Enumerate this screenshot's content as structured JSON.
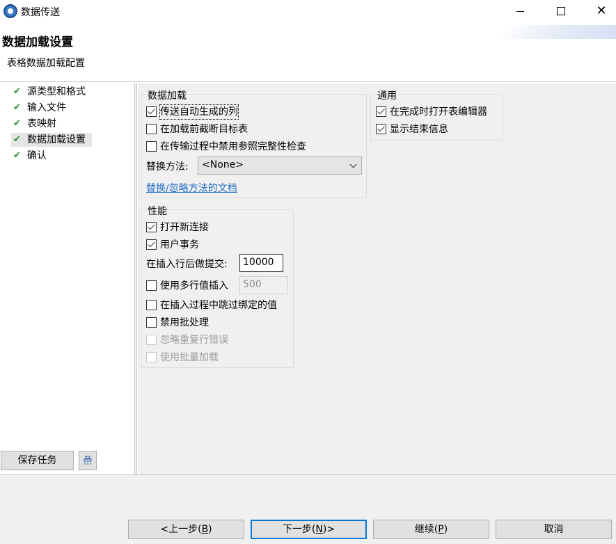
{
  "window": {
    "title": "数据传送",
    "icon": "app-icon",
    "controls": [
      "minimize-icon",
      "maximize-icon",
      "close-icon"
    ],
    "close_glyph": "✕"
  },
  "header": {
    "title": "数据加载设置",
    "subtitle": "表格数据加载配置"
  },
  "sidebar": {
    "steps": [
      {
        "label": "源类型和格式",
        "done": true
      },
      {
        "label": "输入文件",
        "done": true
      },
      {
        "label": "表映射",
        "done": true
      },
      {
        "label": "数据加载设置",
        "done": true,
        "active": true
      },
      {
        "label": "确认",
        "done": true
      }
    ],
    "check_glyph": "✔",
    "save_task": "保存任务",
    "tool_icon": "stamp-icon"
  },
  "data_load": {
    "legend": "数据加载",
    "options": [
      {
        "label": "传送自动生成的列",
        "checked": true
      },
      {
        "label": "在加载前截断目标表",
        "checked": false
      },
      {
        "label": "在传输过程中禁用参照完整性检查",
        "checked": false
      }
    ],
    "replace_method_label": "替换方法:",
    "replace_method_value": "<None>",
    "doc_link": "替换/忽略方法的文档"
  },
  "general": {
    "legend": "通用",
    "options": [
      {
        "label": "在完成时打开表编辑器",
        "checked": true
      },
      {
        "label": "显示结束信息",
        "checked": true
      }
    ]
  },
  "performance": {
    "legend": "性能",
    "open_new_connection": {
      "label": "打开新连接",
      "checked": true
    },
    "user_transaction": {
      "label": "用户事务",
      "checked": true
    },
    "commit_after_label": "在插入行后做提交:",
    "commit_after_value": "10000",
    "multi_row_insert": {
      "label": "使用多行值插入",
      "checked": false
    },
    "multi_row_value": "500",
    "skip_bound_values": {
      "label": "在插入过程中跳过绑定的值",
      "checked": false
    },
    "disable_batch": {
      "label": "禁用批处理",
      "checked": false
    },
    "ignore_duplicate": {
      "label": "忽略重复行错误",
      "checked": false,
      "disabled": true
    },
    "use_bulk_load": {
      "label": "使用批量加载",
      "checked": false,
      "disabled": true
    }
  },
  "footer": {
    "back": {
      "prefix": "<上一步(",
      "key": "B",
      "suffix": ")"
    },
    "next": {
      "prefix": "下一步(",
      "key": "N",
      "suffix": ")>"
    },
    "continue": {
      "prefix": "继续(",
      "key": "P",
      "suffix": ")"
    },
    "cancel": "取消"
  },
  "colors": {
    "accent": "#0078d7",
    "check_green": "#2f8a3a",
    "link": "#1f6ec6",
    "panel_bg": "#f0f0f0"
  }
}
